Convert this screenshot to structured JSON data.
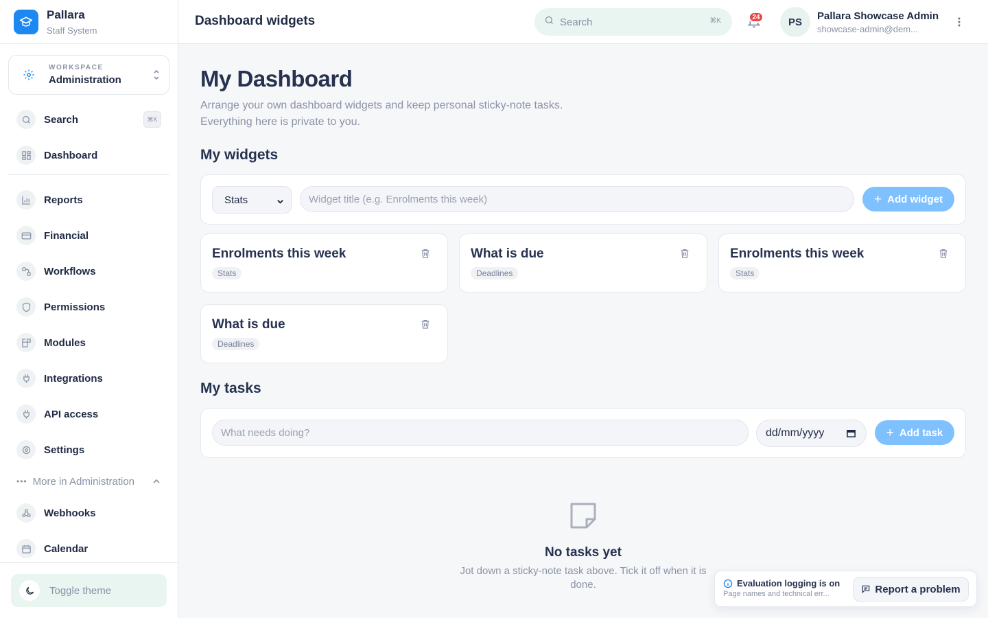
{
  "brand": {
    "name": "Pallara",
    "subtitle": "Staff System"
  },
  "workspace": {
    "label": "WORKSPACE",
    "value": "Administration"
  },
  "sidebar": {
    "items": [
      {
        "label": "Search",
        "icon": "search-icon",
        "shortcut": "⌘K"
      },
      {
        "label": "Dashboard",
        "icon": "dashboard-icon"
      },
      {
        "label": "Reports",
        "icon": "bar-chart-icon"
      },
      {
        "label": "Financial",
        "icon": "credit-card-icon"
      },
      {
        "label": "Workflows",
        "icon": "workflow-icon"
      },
      {
        "label": "Permissions",
        "icon": "shield-icon"
      },
      {
        "label": "Modules",
        "icon": "blocks-icon"
      },
      {
        "label": "Integrations",
        "icon": "plug-icon"
      },
      {
        "label": "API access",
        "icon": "plug-icon"
      },
      {
        "label": "Settings",
        "icon": "gear-icon"
      }
    ],
    "more": {
      "label": "More in Administration"
    },
    "more_items": [
      {
        "label": "Webhooks",
        "icon": "webhook-icon"
      },
      {
        "label": "Calendar",
        "icon": "calendar-icon"
      }
    ],
    "toggle_theme": "Toggle theme"
  },
  "topbar": {
    "title": "Dashboard widgets",
    "search_placeholder": "Search",
    "search_shortcut": "⌘K",
    "notifications_count": "24",
    "user_initials": "PS",
    "user_name": "Pallara Showcase Admin",
    "user_email": "showcase-admin@dem..."
  },
  "main": {
    "title": "My Dashboard",
    "description_line1": "Arrange your own dashboard widgets and keep personal sticky-note tasks.",
    "description_line2": "Everything here is private to you.",
    "widgets_section": {
      "title": "My widgets",
      "type_select": "Stats",
      "title_placeholder": "Widget title (e.g. Enrolments this week)",
      "add_label": "Add widget"
    },
    "widgets": [
      {
        "title": "Enrolments this week",
        "tag": "Stats"
      },
      {
        "title": "What is due",
        "tag": "Deadlines"
      },
      {
        "title": "Enrolments this week",
        "tag": "Stats"
      },
      {
        "title": "What is due",
        "tag": "Deadlines"
      }
    ],
    "tasks_section": {
      "title": "My tasks",
      "task_placeholder": "What needs doing?",
      "date_placeholder": "dd/mm/yyyy",
      "add_label": "Add task"
    },
    "empty": {
      "title": "No tasks yet",
      "description": "Jot down a sticky-note task above. Tick it off when it is done."
    }
  },
  "eval_toast": {
    "title": "Evaluation logging is on",
    "subtitle": "Page names and technical err...",
    "report_label": "Report a problem"
  },
  "colors": {
    "accent": "#1e88f2",
    "button_primary": "#7fc0ff",
    "badge": "#e84545",
    "search_bg": "#e8f5f0"
  }
}
